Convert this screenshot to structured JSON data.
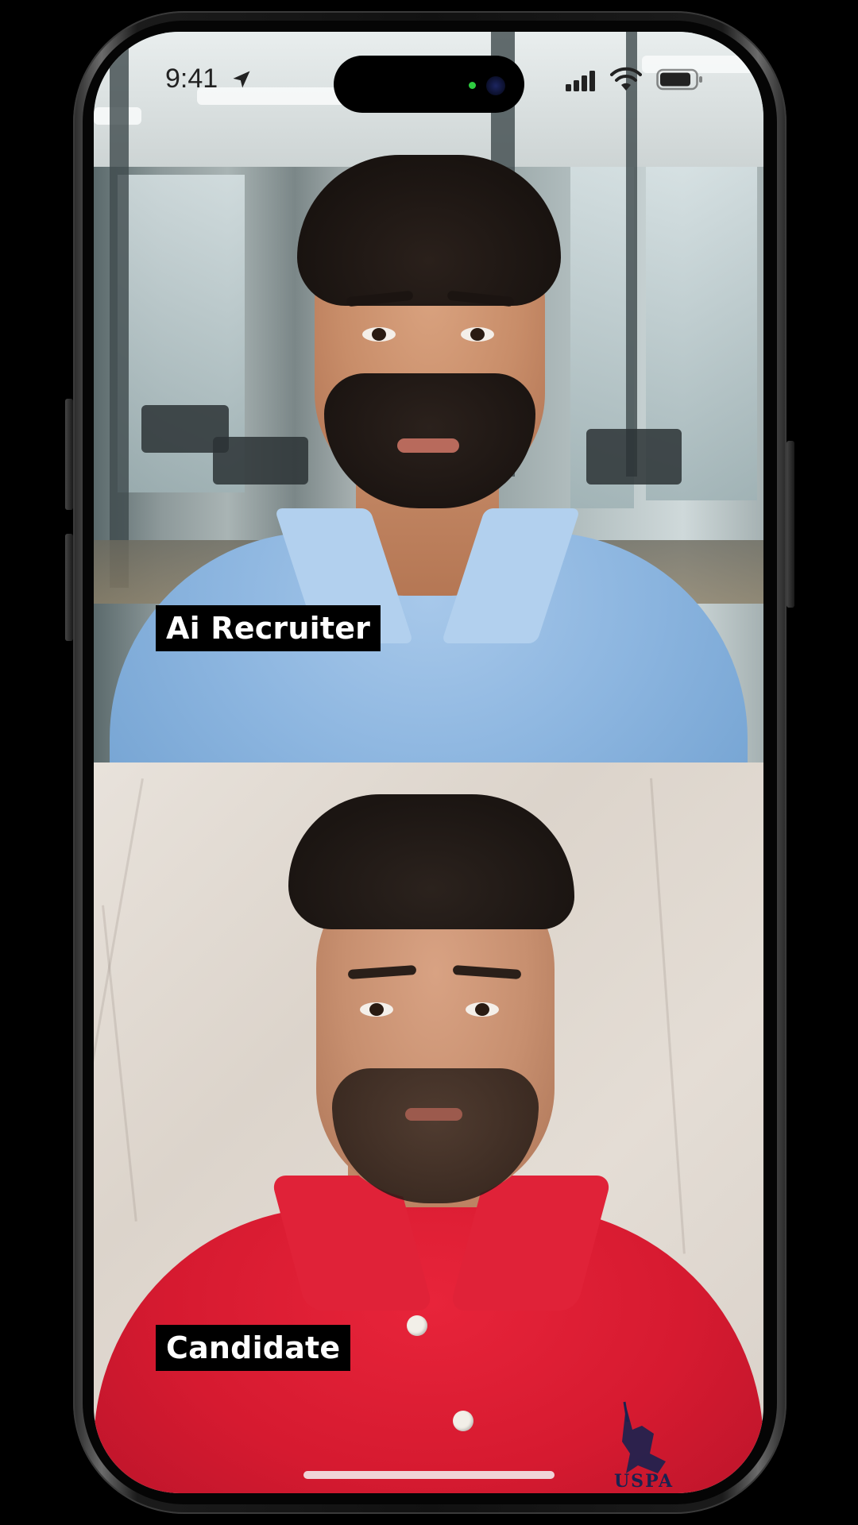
{
  "status_bar": {
    "time": "9:41",
    "icons": [
      "location-arrow-icon",
      "cellular-signal-icon",
      "wifi-icon",
      "battery-icon"
    ]
  },
  "call": {
    "participants": [
      {
        "role": "recruiter",
        "label": "Ai Recruiter"
      },
      {
        "role": "candidate",
        "label": "Candidate"
      }
    ]
  },
  "candidate_shirt": {
    "logo_text": "USPA"
  },
  "colors": {
    "label_bg": "#000000",
    "label_text": "#ffffff",
    "recruiter_shirt": "#8db6e0",
    "candidate_shirt": "#d61a30"
  }
}
